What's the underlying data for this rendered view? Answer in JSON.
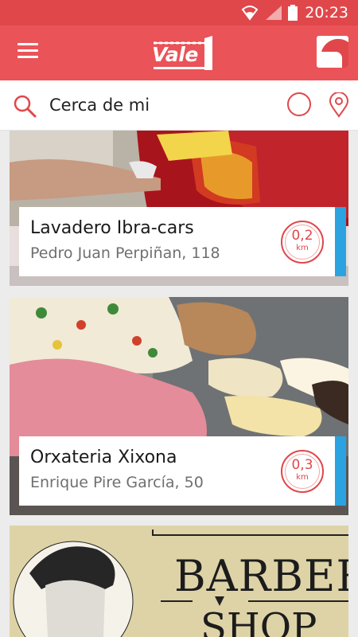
{
  "status_bar": {
    "time": "20:23",
    "icons": [
      "wifi-icon",
      "signal-icon",
      "battery-icon"
    ]
  },
  "app_bar": {
    "logo_text": "Vale",
    "logo_badge": "1",
    "menu_icon": "hamburger-icon",
    "profile_icon": "profile-icon"
  },
  "search": {
    "value": "Cerca de mi",
    "icon": "search-icon"
  },
  "filters": {
    "circle_icon": "circle-icon",
    "location_icon": "location-pin-icon"
  },
  "colors": {
    "brand": "#ea5358",
    "status": "#e0474b",
    "accent": "#2aa3e0"
  },
  "businesses": [
    {
      "name": "Lavadero Ibra-cars",
      "address": "Pedro Juan Perpiñan, 118",
      "distance": "0,2",
      "unit": "km"
    },
    {
      "name": "Orxateria Xixona",
      "address": "Enrique Pire García, 50",
      "distance": "0,3",
      "unit": "km"
    },
    {
      "image_text_1": "BARBER",
      "image_text_2": "SHOP"
    }
  ]
}
